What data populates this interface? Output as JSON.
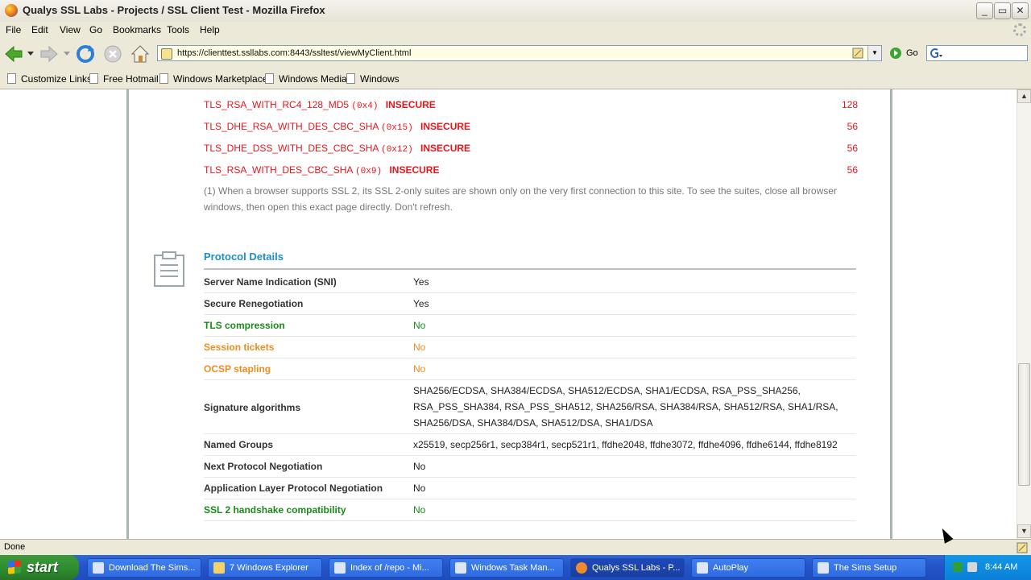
{
  "window": {
    "title": "Qualys SSL Labs - Projects / SSL Client Test - Mozilla Firefox",
    "minimize": "_",
    "maximize": "▭",
    "close": "✕"
  },
  "menu": [
    "File",
    "Edit",
    "View",
    "Go",
    "Bookmarks",
    "Tools",
    "Help"
  ],
  "nav": {
    "url": "https://clienttest.ssllabs.com:8443/ssltest/viewMyClient.html",
    "go_label": "Go"
  },
  "bookmarks": [
    "Customize Links",
    "Free Hotmail",
    "Windows Marketplace",
    "Windows Media",
    "Windows"
  ],
  "cipher_suites": [
    {
      "name": "TLS_RSA_WITH_RC4_128_MD5",
      "hex": "(0x4)",
      "status": "INSECURE",
      "bits": "128"
    },
    {
      "name": "TLS_DHE_RSA_WITH_DES_CBC_SHA",
      "hex": "(0x15)",
      "status": "INSECURE",
      "bits": "56"
    },
    {
      "name": "TLS_DHE_DSS_WITH_DES_CBC_SHA",
      "hex": "(0x12)",
      "status": "INSECURE",
      "bits": "56"
    },
    {
      "name": "TLS_RSA_WITH_DES_CBC_SHA",
      "hex": "(0x9)",
      "status": "INSECURE",
      "bits": "56"
    }
  ],
  "note": "(1) When a browser supports SSL 2, its SSL 2-only suites are shown only on the very first connection to this site. To see the suites, close all browser windows, then open this exact page directly. Don't refresh.",
  "protocol_details": {
    "heading": "Protocol Details",
    "rows": [
      {
        "label": "Server Name Indication (SNI)",
        "value": "Yes",
        "color": "default"
      },
      {
        "label": "Secure Renegotiation",
        "value": "Yes",
        "color": "default"
      },
      {
        "label": "TLS compression",
        "value": "No",
        "color": "green"
      },
      {
        "label": "Session tickets",
        "value": "No",
        "color": "orange"
      },
      {
        "label": "OCSP stapling",
        "value": "No",
        "color": "orange"
      },
      {
        "label": "Signature algorithms",
        "value": "SHA256/ECDSA, SHA384/ECDSA, SHA512/ECDSA, SHA1/ECDSA, RSA_PSS_SHA256, RSA_PSS_SHA384, RSA_PSS_SHA512, SHA256/RSA, SHA384/RSA, SHA512/RSA, SHA1/RSA, SHA256/DSA, SHA384/DSA, SHA512/DSA, SHA1/DSA",
        "color": "default"
      },
      {
        "label": "Named Groups",
        "value": "x25519, secp256r1, secp384r1, secp521r1, ffdhe2048, ffdhe3072, ffdhe4096, ffdhe6144, ffdhe8192",
        "color": "default"
      },
      {
        "label": "Next Protocol Negotiation",
        "value": "No",
        "color": "default"
      },
      {
        "label": "Application Layer Protocol Negotiation",
        "value": "No",
        "color": "default"
      },
      {
        "label": "SSL 2 handshake compatibility",
        "value": "No",
        "color": "green"
      }
    ]
  },
  "colors": {
    "insecure": "#e8151b",
    "heading": "#1c8fc4",
    "good": "#1a8a1a",
    "warn": "#f08c1e"
  },
  "status": "Done",
  "taskbar": {
    "start": "start",
    "tasks": [
      {
        "label": "Download The Sims...",
        "icon": "web-icon",
        "active": false
      },
      {
        "label": "7 Windows Explorer",
        "icon": "folder-icon",
        "active": false
      },
      {
        "label": "Index of /repo - Mi...",
        "icon": "ie-icon",
        "active": false
      },
      {
        "label": "Windows Task Man...",
        "icon": "taskmgr-icon",
        "active": false
      },
      {
        "label": "Qualys SSL Labs - P...",
        "icon": "firefox-icon",
        "active": true
      },
      {
        "label": "AutoPlay",
        "icon": "autoplay-icon",
        "active": false
      },
      {
        "label": "The Sims Setup",
        "icon": "setup-icon",
        "active": false
      }
    ],
    "clock": "8:44 AM"
  }
}
